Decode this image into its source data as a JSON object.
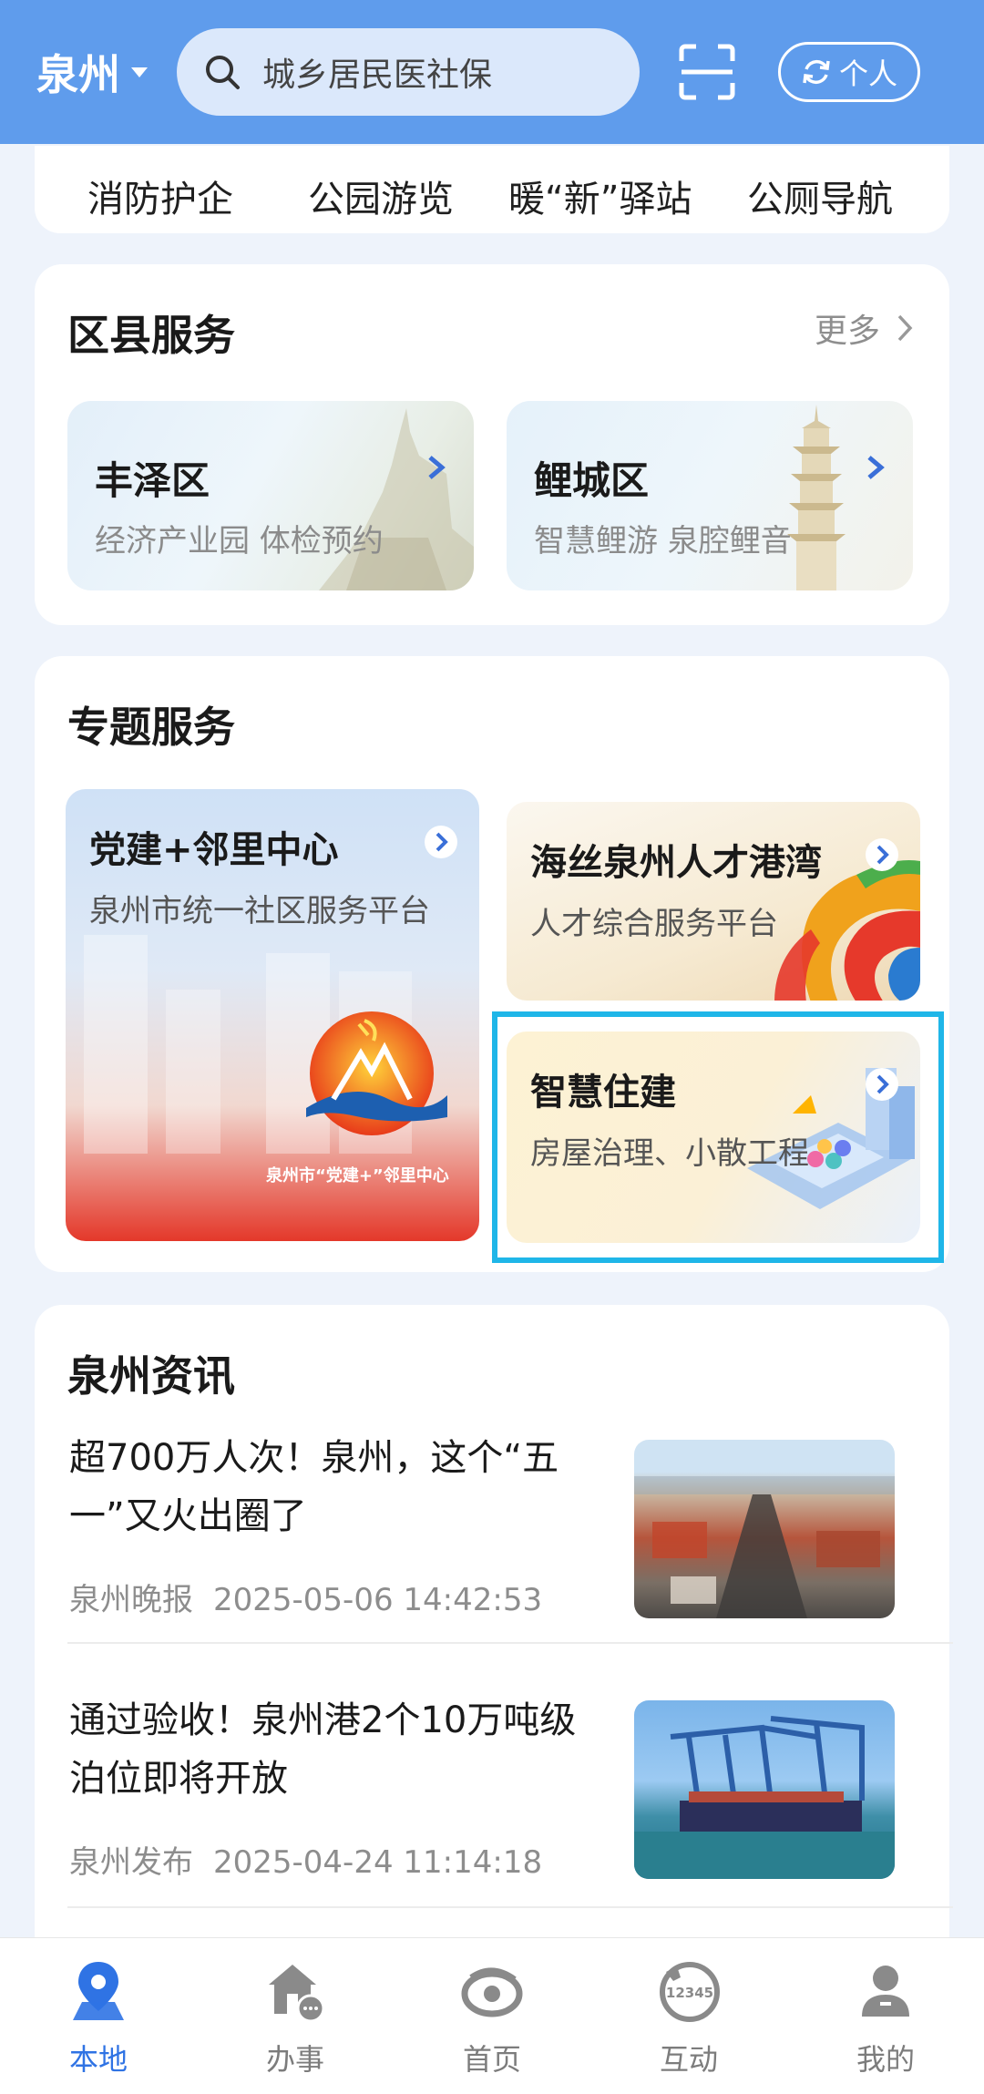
{
  "header": {
    "city": "泉州",
    "search_placeholder": "城乡居民医社保",
    "personal_label": "个人"
  },
  "quick_links": [
    "消防护企",
    "公园游览",
    "暖“新”驿站",
    "公厕导航"
  ],
  "district_services": {
    "title": "区县服务",
    "more_label": "更多",
    "items": [
      {
        "name": "丰泽区",
        "desc": "经济产业园  体检预约"
      },
      {
        "name": "鲤城区",
        "desc": "智慧鲤游 泉腔鲤音"
      }
    ]
  },
  "topic_services": {
    "title": "专题服务",
    "items": [
      {
        "name": "党建+邻里中心",
        "desc": "泉州市统一社区服务平台",
        "badge_text": "泉州市“党建+”邻里中心"
      },
      {
        "name": "海丝泉州人才港湾",
        "desc": "人才综合服务平台"
      },
      {
        "name": "智慧住建",
        "desc": "房屋治理、小散工程"
      }
    ]
  },
  "news": {
    "title": "泉州资讯",
    "items": [
      {
        "title": "超700万人次！泉州，这个“五一”又火出圈了",
        "source": "泉州晚报",
        "time": "2025-05-06 14:42:53"
      },
      {
        "title": "通过验收！泉州港2个10万吨级泊位即将开放",
        "source": "泉州发布",
        "time": "2025-04-24 11:14:18"
      }
    ]
  },
  "bottom_nav": [
    {
      "label": "本地",
      "icon": "location-pin-icon",
      "active": true
    },
    {
      "label": "办事",
      "icon": "service-hall-icon",
      "active": false
    },
    {
      "label": "首页",
      "icon": "home-logo-icon",
      "active": false
    },
    {
      "label": "互动",
      "icon": "hotline-12345-icon",
      "active": false,
      "icon_text": "12345"
    },
    {
      "label": "我的",
      "icon": "user-profile-icon",
      "active": false
    }
  ],
  "colors": {
    "header_bg": "#5f9cec",
    "accent": "#2f73e4",
    "highlight_border": "#1fb6e8"
  }
}
